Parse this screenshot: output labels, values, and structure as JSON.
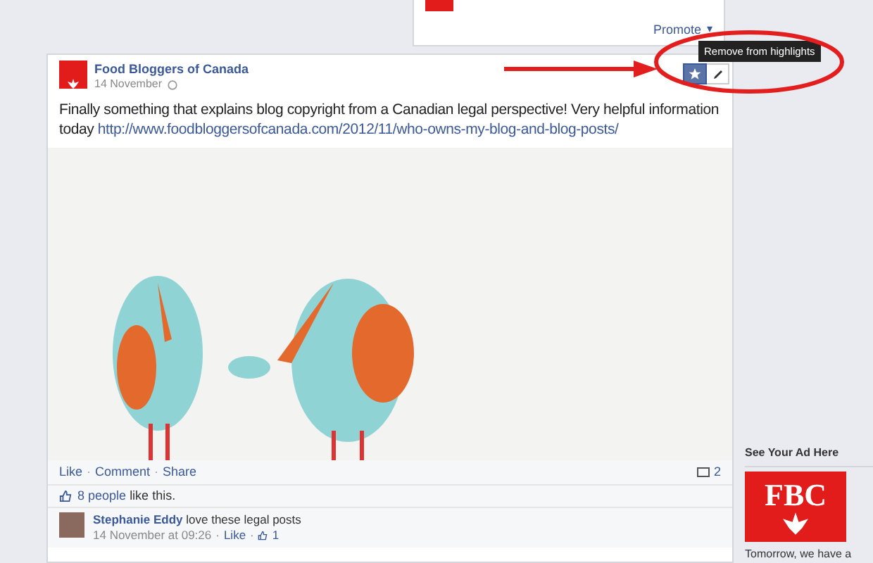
{
  "top_card": {
    "action": "Promote",
    "caret": "▾"
  },
  "post": {
    "author": "Food Bloggers of Canada",
    "date": "14 November",
    "highlighted": true,
    "tooltip": "Remove from highlights",
    "text": "Finally something that explains blog copyright from a Canadian legal perspective! Very helpful information today",
    "link": "http://www.foodbloggersofcanada.com/2012/11/who-owns-my-blog-and-blog-posts/",
    "actions": [
      "Like",
      "Comment",
      "Share"
    ],
    "separator": "·",
    "comment_count": "2",
    "likes": {
      "link": "8 people",
      "rest": "like this."
    },
    "comments": [
      {
        "author": "Stephanie Eddy",
        "text": "love these legal posts",
        "time": "14 November at 09:26",
        "like": "Like",
        "like_count": "1"
      }
    ]
  },
  "ad": {
    "title": "See Your Ad Here",
    "logo_text": "FBC",
    "text": "Tomorrow, we have a"
  }
}
